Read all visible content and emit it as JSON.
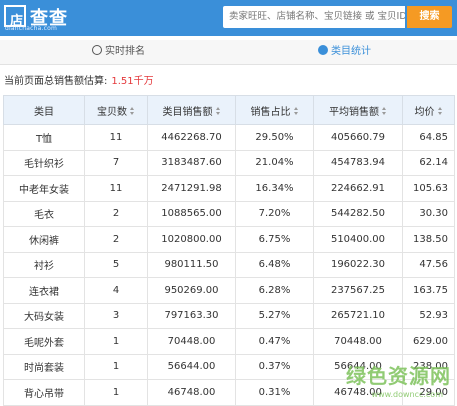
{
  "header": {
    "logo_mark": "店",
    "logo_title": "查查",
    "logo_sub": "dianchacha.com",
    "search_placeholder": "卖家旺旺、店铺名称、宝贝链接 或 宝贝ID",
    "search_button": "搜索"
  },
  "tabs": [
    {
      "label": "实时排名",
      "active": false
    },
    {
      "label": "类目统计",
      "active": true
    }
  ],
  "summary": {
    "label": "当前页面总销售额估算:",
    "value": "1.51千万"
  },
  "table": {
    "headers": [
      "类目",
      "宝贝数",
      "类目销售额",
      "销售占比",
      "平均销售额",
      "均价"
    ],
    "rows": [
      [
        "T恤",
        "11",
        "4462268.70",
        "29.50%",
        "405660.79",
        "64.85"
      ],
      [
        "毛针织衫",
        "7",
        "3183487.60",
        "21.04%",
        "454783.94",
        "62.14"
      ],
      [
        "中老年女装",
        "11",
        "2471291.98",
        "16.34%",
        "224662.91",
        "105.63"
      ],
      [
        "毛衣",
        "2",
        "1088565.00",
        "7.20%",
        "544282.50",
        "30.30"
      ],
      [
        "休闲裤",
        "2",
        "1020800.00",
        "6.75%",
        "510400.00",
        "138.50"
      ],
      [
        "衬衫",
        "5",
        "980111.50",
        "6.48%",
        "196022.30",
        "47.56"
      ],
      [
        "连衣裙",
        "4",
        "950269.00",
        "6.28%",
        "237567.25",
        "163.75"
      ],
      [
        "大码女装",
        "3",
        "797163.30",
        "5.27%",
        "265721.10",
        "52.93"
      ],
      [
        "毛呢外套",
        "1",
        "70448.00",
        "0.47%",
        "70448.00",
        "629.00"
      ],
      [
        "时尚套装",
        "1",
        "56644.00",
        "0.37%",
        "56644.00",
        "238.00"
      ],
      [
        "背心吊带",
        "1",
        "46748.00",
        "0.31%",
        "46748.00",
        "29.00"
      ]
    ]
  },
  "watermark": {
    "title": "绿色资源网",
    "sub": "www.downcc.com"
  },
  "colors": {
    "header_bg": "#3a8fd9",
    "accent": "#3a8fd9",
    "search_button": "#f59a23",
    "summary_value": "#e4393c",
    "watermark": "#7ec35c"
  }
}
